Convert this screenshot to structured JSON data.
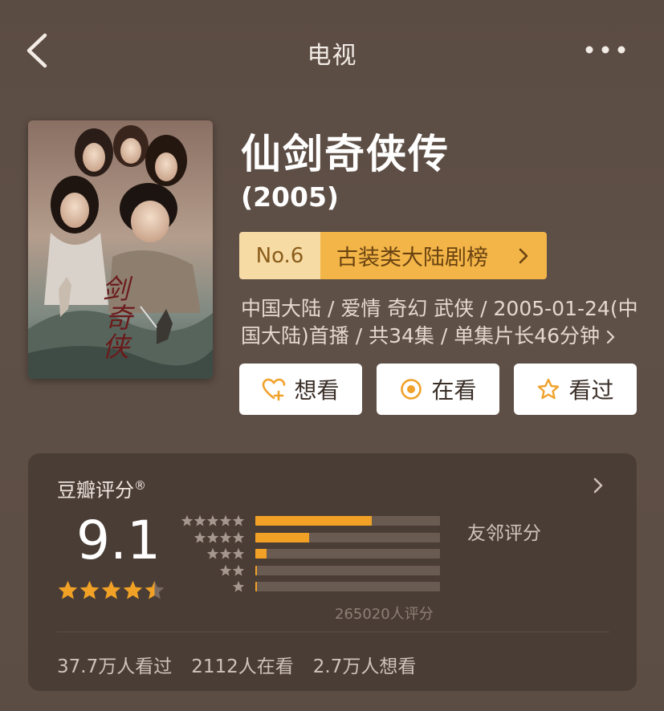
{
  "nav": {
    "title": "电视"
  },
  "movie": {
    "title": "仙剑奇侠传",
    "year": "(2005)",
    "rank": {
      "number": "No.6",
      "list_name": "古装类大陆剧榜"
    },
    "meta_line1": "中国大陆 / 爱情 奇幻 武侠 / 2005-01-24(中",
    "meta_line2": "国大陆)首播 / 共34集 / 单集片长46分钟",
    "poster_text": "剑奇侠传"
  },
  "actions": {
    "want": {
      "label": "想看",
      "icon": "heart-plus-icon"
    },
    "doing": {
      "label": "在看",
      "icon": "target-circle-icon"
    },
    "done": {
      "label": "看过",
      "icon": "star-outline-icon"
    }
  },
  "rating": {
    "title": "豆瓣评分",
    "reg_mark": "®",
    "score": "9.1",
    "stars_value": 4.5,
    "distribution": [
      {
        "stars": 5,
        "fraction": 0.63
      },
      {
        "stars": 4,
        "fraction": 0.29
      },
      {
        "stars": 3,
        "fraction": 0.06
      },
      {
        "stars": 2,
        "fraction": 0.01
      },
      {
        "stars": 1,
        "fraction": 0.01
      }
    ],
    "total": "265020人评分",
    "neighbor": "友邻评分"
  },
  "stats": {
    "watched": "37.7万人看过",
    "watching": "2112人在看",
    "want": "2.7万人想看"
  },
  "colors": {
    "background": "#5e4f45",
    "card": "#4a3d35",
    "accent_orange": "#f1a226",
    "rank_light": "#f7dba5",
    "rank_dark": "#f3b548"
  }
}
